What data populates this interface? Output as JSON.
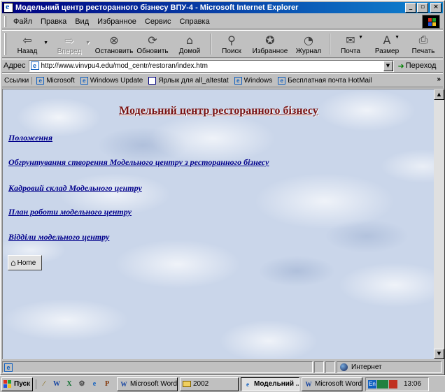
{
  "window": {
    "title": "Модельний центр ресторанного бізнесу ВПУ-4 - Microsoft Internet Explorer",
    "caption_buttons": [
      "_",
      "▫",
      "×"
    ]
  },
  "menu": {
    "items": [
      "Файл",
      "Правка",
      "Вид",
      "Избранное",
      "Сервис",
      "Справка"
    ]
  },
  "toolbar": {
    "buttons": [
      {
        "label": "Назад",
        "icon": "back-arrow-icon"
      },
      {
        "label": "Вперед",
        "icon": "forward-arrow-icon"
      },
      {
        "label": "Остановить",
        "icon": "stop-icon"
      },
      {
        "label": "Обновить",
        "icon": "refresh-icon"
      },
      {
        "label": "Домой",
        "icon": "home-icon"
      },
      {
        "label": "Поиск",
        "icon": "search-icon"
      },
      {
        "label": "Избранное",
        "icon": "favorites-icon"
      },
      {
        "label": "Журнал",
        "icon": "history-icon"
      },
      {
        "label": "Почта",
        "icon": "mail-icon"
      },
      {
        "label": "Размер",
        "icon": "font-size-icon"
      },
      {
        "label": "Печать",
        "icon": "print-icon"
      }
    ]
  },
  "address": {
    "label": "Адрес",
    "url": "http://www.vinvpu4.edu/mod_centr/restoran/index.htm",
    "go_label": "Переход"
  },
  "links": {
    "label": "Ссылки",
    "items": [
      "Microsoft",
      "Windows Update",
      "Ярлык для all_altestat",
      "Windows",
      "Бесплатная почта HotMail"
    ]
  },
  "page": {
    "heading": "Модельний центр ресторанного бізнесу",
    "links": [
      "Положення",
      "Обгрунтування створення Модельного центру з ресторанного бізнесу",
      "Кадровий склад Модельного центру",
      "План роботи модельного центру",
      "Відділи модельного центру"
    ],
    "home_button": "Home",
    "heading_color": "#7a1414",
    "link_color": "#00008b"
  },
  "status": {
    "zone": "Интернет"
  },
  "taskbar": {
    "start": "Пуск",
    "tasks": [
      "Microsoft Word ...",
      "2002",
      "Модельний ...",
      "Microsoft Word ..."
    ],
    "active_task_index": 2,
    "tray_lang": "En",
    "clock": "13:06"
  },
  "colors": {
    "titlebar_start": "#000080",
    "titlebar_end": "#1084d0",
    "chrome": "#c0c0c0"
  }
}
